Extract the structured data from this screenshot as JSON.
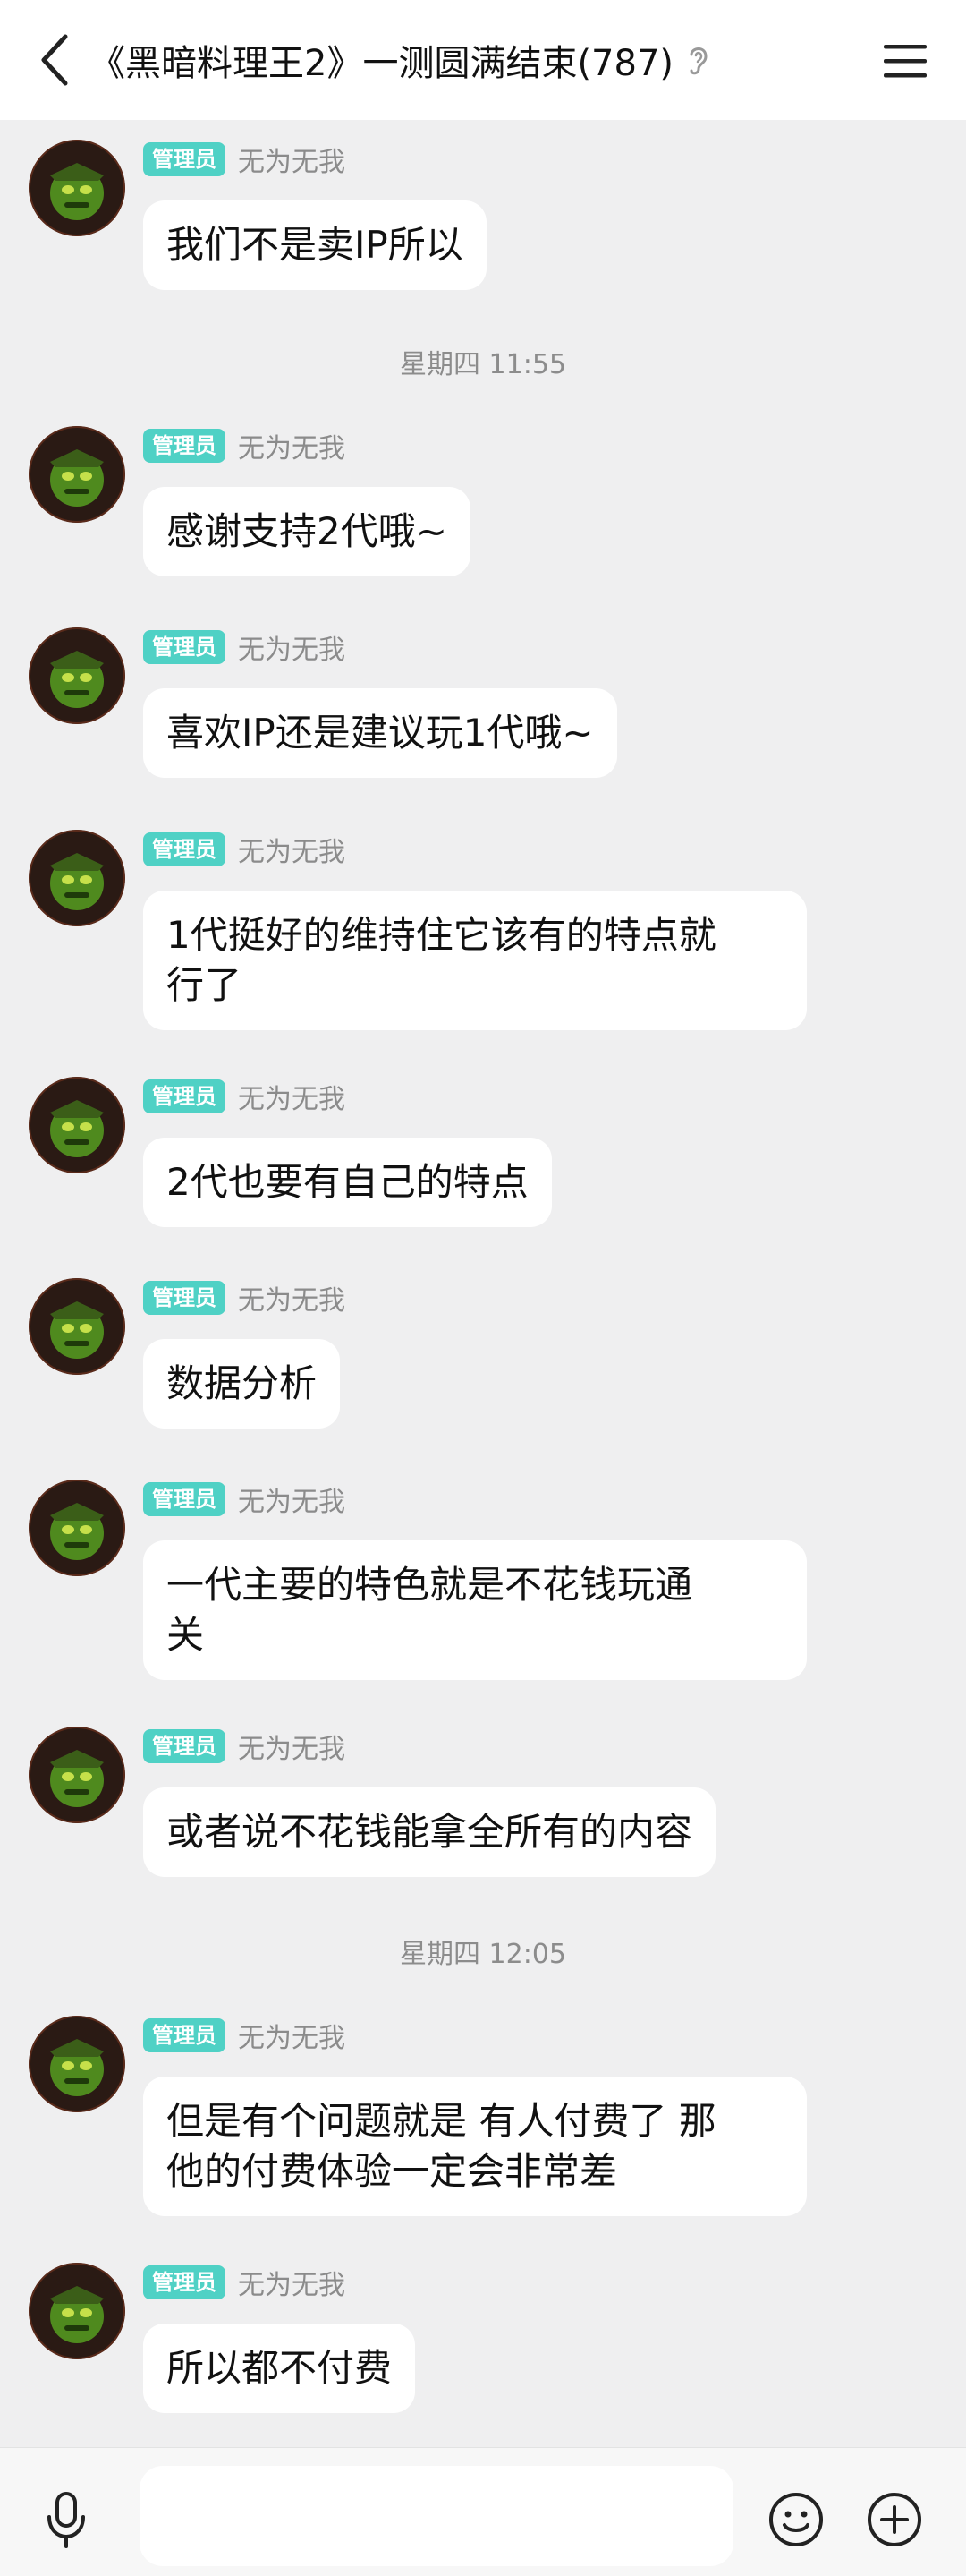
{
  "header": {
    "title": "《黑暗料理王2》一测圆满结束(787)",
    "back_icon": "chevron-left-icon",
    "ear_icon": "ear-icon",
    "menu_icon": "hamburger-menu-icon"
  },
  "sender": {
    "badge": "管理员",
    "name": "无为无我",
    "badge_color": "#4fd1c5"
  },
  "timestamps": {
    "t1": "星期四 11:55",
    "t2": "星期四 12:05"
  },
  "messages": [
    {
      "text": "我们不是卖IP所以"
    },
    {
      "text": "感谢支持2代哦~"
    },
    {
      "text": "喜欢IP还是建议玩1代哦~"
    },
    {
      "line1": "1代挺好的维持住它该有的特点就",
      "line2": "行了"
    },
    {
      "text": "2代也要有自己的特点"
    },
    {
      "text": "数据分析"
    },
    {
      "line1": "一代主要的特色就是不花钱玩通",
      "line2": "关"
    },
    {
      "text": "或者说不花钱能拿全所有的内容"
    },
    {
      "line1": "但是有个问题就是 有人付费了 那",
      "line2": "他的付费体验一定会非常差"
    },
    {
      "text": "所以都不付费"
    }
  ],
  "bottom_bar": {
    "mic_icon": "microphone-icon",
    "input_value": "",
    "emoji_icon": "smiley-icon",
    "plus_icon": "plus-circle-icon"
  }
}
